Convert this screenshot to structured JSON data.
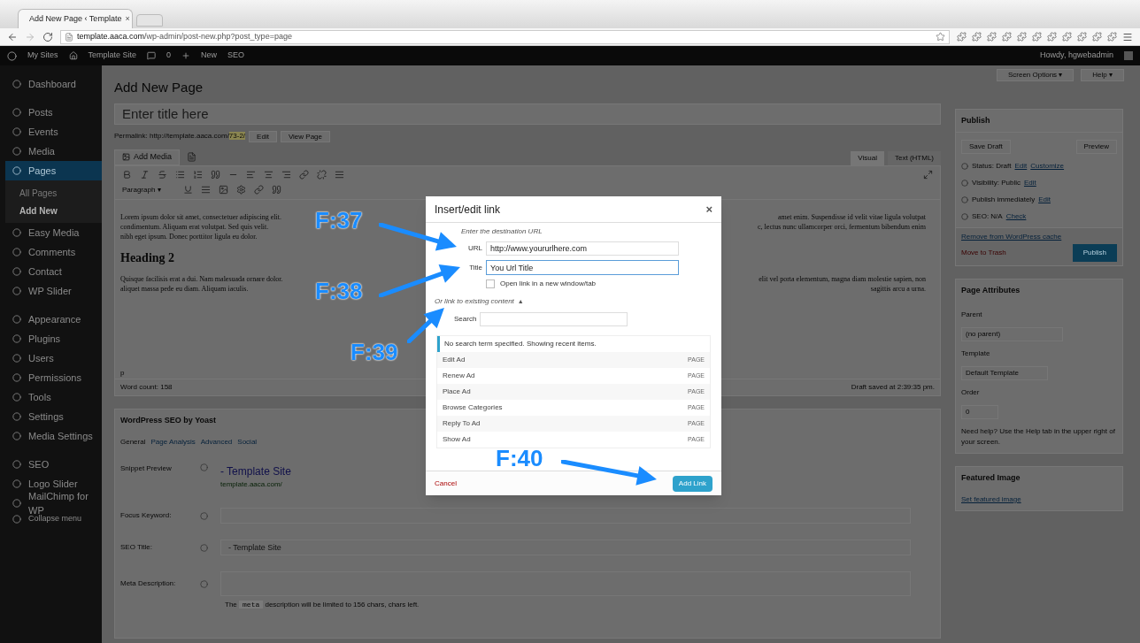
{
  "browser": {
    "tab_title": "Add New Page ‹ Template",
    "tab_close": "×",
    "url_domain": "template.aaca.com",
    "url_path": "/wp-admin/post-new.php?post_type=page"
  },
  "admin_bar": {
    "items": [
      "My Sites",
      "Template Site",
      "0",
      "New",
      "SEO"
    ],
    "greeting": "Howdy, hgwebadmin"
  },
  "sidebar": {
    "groups": [
      [
        {
          "label": "Dashboard",
          "selected": false
        }
      ],
      [
        {
          "label": "Posts",
          "selected": false
        },
        {
          "label": "Events",
          "selected": false
        },
        {
          "label": "Media",
          "selected": false
        },
        {
          "label": "Pages",
          "selected": true,
          "children": [
            {
              "label": "All Pages",
              "selected": false
            },
            {
              "label": "Add New",
              "selected": true
            }
          ]
        },
        {
          "label": "Easy Media",
          "selected": false
        },
        {
          "label": "Comments",
          "selected": false
        },
        {
          "label": "Contact",
          "selected": false
        },
        {
          "label": "WP Slider",
          "selected": false
        }
      ],
      [
        {
          "label": "Appearance",
          "selected": false
        },
        {
          "label": "Plugins",
          "selected": false
        },
        {
          "label": "Users",
          "selected": false
        },
        {
          "label": "Permissions",
          "selected": false
        },
        {
          "label": "Tools",
          "selected": false
        },
        {
          "label": "Settings",
          "selected": false
        },
        {
          "label": "Media Settings",
          "selected": false
        }
      ],
      [
        {
          "label": "SEO",
          "selected": false
        },
        {
          "label": "Logo Slider",
          "selected": false
        },
        {
          "label": "MailChimp for WP",
          "selected": false
        }
      ]
    ],
    "collapse": "Collapse menu"
  },
  "screen_buttons": [
    "Screen Options ▾",
    "Help ▾"
  ],
  "page_title": "Add New Page",
  "title_field": {
    "placeholder": "Enter title here"
  },
  "permalink": {
    "label": "Permalink:",
    "url": "http://template.aaca.com/",
    "slug": "73-2/",
    "buttons": [
      "Edit",
      "View Page"
    ]
  },
  "add_media": "Add Media",
  "editor_tabs": [
    {
      "label": "Visual",
      "selected": true
    },
    {
      "label": "Text (HTML)",
      "selected": false
    }
  ],
  "format_select": "Paragraph ▾",
  "content": [
    {
      "kind": "paragraph",
      "lines": [
        {
          "left": "Lorem ipsum dolor sit amet, consectetuer adipiscing elit.",
          "right": "amet enim. Suspendisse id velit vitae ligula volutpat"
        },
        {
          "left": "condimentum. Aliquam erat volutpat. Sed quis velit.",
          "right": "c, lectus nunc ullamcorper orci, fermentum bibendum enim"
        },
        {
          "left": "nibh eget ipsum. Donec porttitor ligula eu dolor."
        }
      ]
    },
    {
      "kind": "heading",
      "text": "Heading 2"
    },
    {
      "kind": "paragraph",
      "lines": [
        {
          "left": "Quisque facilisis erat a dui. Nam malesuada ornare dolor.",
          "right": "elit vel porta elementum, magna diam molestie sapien, non"
        },
        {
          "left": "aliquet massa pede eu diam. Aliquam iaculis.",
          "right": "sagittis arcu a urna."
        }
      ]
    }
  ],
  "editor_path": "p",
  "word_count": "Word count: 158",
  "draft_saved": "Draft saved at 2:39:35 pm.",
  "seo_box": {
    "title": "WordPress SEO by Yoast",
    "tabs": [
      {
        "label": "General",
        "selected": true
      },
      {
        "label": "Page Analysis",
        "selected": false
      },
      {
        "label": "Advanced",
        "selected": false
      },
      {
        "label": "Social",
        "selected": false
      }
    ],
    "snippet_label": "Snippet Preview",
    "snippet_title": "- Template Site",
    "snippet_url": "template.aaca.com/",
    "fields": [
      {
        "label": "Focus Keyword:"
      },
      {
        "label": "SEO Title:",
        "placeholder": "- Template Site"
      },
      {
        "label": "Meta Description:"
      }
    ],
    "note_before": "The",
    "note_code": "meta",
    "note_after": "description will be limited to 156 chars, chars left."
  },
  "publish": {
    "title": "Publish",
    "save_draft": "Save Draft",
    "preview": "Preview",
    "rows": [
      {
        "text": "Status: Draft",
        "links": [
          "Edit",
          "Customize"
        ]
      },
      {
        "text": "Visibility: Public",
        "links": [
          "Edit"
        ]
      },
      {
        "text": "Publish immediately",
        "links": [
          "Edit"
        ]
      },
      {
        "text": "SEO: N/A",
        "links": [
          "Check"
        ]
      }
    ],
    "cache_link": "Remove from WordPress cache",
    "trash": "Move to Trash",
    "button": "Publish"
  },
  "page_attributes": {
    "title": "Page Attributes",
    "parent_label": "Parent",
    "parent_value": "(no parent)",
    "template_label": "Template",
    "template_value": "Default Template",
    "order_label": "Order",
    "order_value": "0",
    "help": "Need help? Use the Help tab in the upper right of your screen."
  },
  "featured_image": {
    "title": "Featured Image",
    "link": "Set featured image"
  },
  "dialog": {
    "title": "Insert/edit link",
    "close": "×",
    "intro": "Enter the destination URL",
    "url_label": "URL",
    "url_value": "http://www.yoururlhere.com",
    "title_label": "Title",
    "title_value": "You Url Title",
    "new_window": {
      "label": "Open link in a new window/tab",
      "checked": false
    },
    "existing": "Or link to existing content",
    "existing_toggle": "▲",
    "search_label": "Search",
    "notice": "No search term specified. Showing recent items.",
    "results": [
      {
        "title": "Edit Ad",
        "type": "PAGE"
      },
      {
        "title": "Renew Ad",
        "type": "PAGE"
      },
      {
        "title": "Place Ad",
        "type": "PAGE"
      },
      {
        "title": "Browse Categories",
        "type": "PAGE"
      },
      {
        "title": "Reply To Ad",
        "type": "PAGE"
      },
      {
        "title": "Show Ad",
        "type": "PAGE"
      }
    ],
    "cancel": "Cancel",
    "add_link": "Add Link"
  },
  "annotations": [
    {
      "label": "F:37"
    },
    {
      "label": "F:38"
    },
    {
      "label": "F:39"
    },
    {
      "label": "F:40"
    }
  ]
}
